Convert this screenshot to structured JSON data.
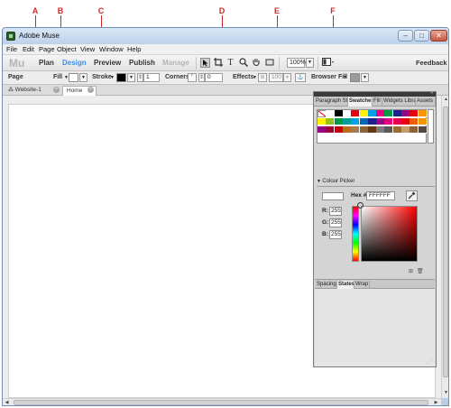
{
  "callouts": [
    "A",
    "B",
    "C",
    "D",
    "E",
    "F"
  ],
  "window": {
    "title": "Adobe Muse"
  },
  "window_controls": {
    "minimize": "–",
    "maximize": "□",
    "close": "✕"
  },
  "menu": [
    "File",
    "Edit",
    "Page",
    "Object",
    "View",
    "Window",
    "Help"
  ],
  "modebar": {
    "logo": "Mu",
    "modes": [
      "Plan",
      "Design",
      "Preview",
      "Publish",
      "Manage"
    ],
    "active_mode": "Design",
    "disabled_mode": "Manage",
    "zoom": "100%",
    "feedback": "Feedback",
    "tools": [
      "pointer-icon",
      "crop-icon",
      "text-icon",
      "zoom-icon",
      "hand-icon",
      "rectangle-icon"
    ]
  },
  "controlbar": {
    "context": "Page",
    "fill": "Fill",
    "stroke": "Stroke",
    "stroke_width": "1",
    "corners": "Corners",
    "corner_radius": "0",
    "effects": "Effects",
    "opacity": "100",
    "browser_fill": "Browser Fill"
  },
  "doc_tabs": {
    "site": "Website-1",
    "page": "Home"
  },
  "panel": {
    "tabs": [
      "Paragraph Sty",
      "Swatches",
      "Fill",
      "Widgets Libra",
      "Assets"
    ],
    "active_tab": "Swatches",
    "swatch_rows": [
      [
        "none",
        "#ffffff",
        "#000000",
        "#ffffff",
        "#e60012",
        "#fff100",
        "#00a0e9",
        "#e4007f",
        "#009944",
        "#1d2088",
        "#920783",
        "#e60012",
        "#f39800"
      ],
      [
        "#fff100",
        "#8fc31f",
        "#009944",
        "#009e96",
        "#00a0e9",
        "#0068b7",
        "#1d2088",
        "#920783",
        "#e4007f",
        "#e5004f",
        "#e60012",
        "#eb6100",
        "#f39800"
      ],
      [
        "#920783",
        "#a40035",
        "#c7000b",
        "#bb6b1e",
        "#a57c52",
        "#8c6239",
        "#603813",
        "#7d7d7d",
        "#5a5a5a",
        "#996c33",
        "#c69c6d",
        "#8c6239",
        "#534741"
      ]
    ],
    "color_picker": {
      "title": "Colour Picker",
      "hex_label": "Hex #:",
      "hex": "FFFFFF",
      "r_label": "R:",
      "r": "255",
      "g_label": "G:",
      "g": "255",
      "b_label": "B:",
      "b": "255"
    },
    "lower_tabs": [
      "Spacing",
      "States",
      "Wrap"
    ],
    "lower_active": "States"
  },
  "colors": {
    "accent": "#3c8ce7",
    "callout": "#d02828"
  }
}
